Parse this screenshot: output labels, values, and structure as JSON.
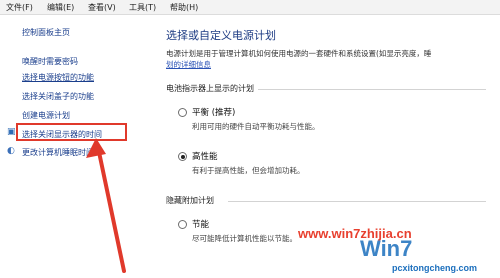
{
  "menu": {
    "file": "文件(F)",
    "edit": "编辑(E)",
    "view": "查看(V)",
    "tools": "工具(T)",
    "help": "帮助(H)"
  },
  "sidebar": {
    "home": "控制面板主页",
    "items": [
      {
        "label": "唤醒时需要密码"
      },
      {
        "label": "选择电源按钮的功能"
      },
      {
        "label": "选择关闭盖子的功能"
      },
      {
        "label": "创建电源计划"
      },
      {
        "label": "选择关闭显示器的时间"
      },
      {
        "label": "更改计算机睡眠时间"
      }
    ]
  },
  "main": {
    "title": "选择或自定义电源计划",
    "desc_line1": "电源计划是用于管理计算机如何使用电源的一套硬件和系统设置(如显示亮度，睡",
    "desc_link": "划的详细信息",
    "battery_section": "电池指示器上显示的计划",
    "plans": [
      {
        "name": "平衡 (推荐)",
        "desc": "利用可用的硬件自动平衡功耗与性能。",
        "checked": false
      },
      {
        "name": "高性能",
        "desc": "有利于提高性能，但会增加功耗。",
        "checked": true
      }
    ],
    "hidden_section": "隐藏附加计划",
    "hidden_plans": [
      {
        "name": "节能",
        "desc": "尽可能降低计算机性能以节能。",
        "checked": false
      }
    ]
  },
  "watermark": {
    "url": "www.win7zhijia.cn",
    "logo": "Win7",
    "domain": "pcxitongcheng.com"
  },
  "colors": {
    "highlight": "#e0392b",
    "arrow": "#e0392b",
    "link": "#1a3e8c"
  }
}
